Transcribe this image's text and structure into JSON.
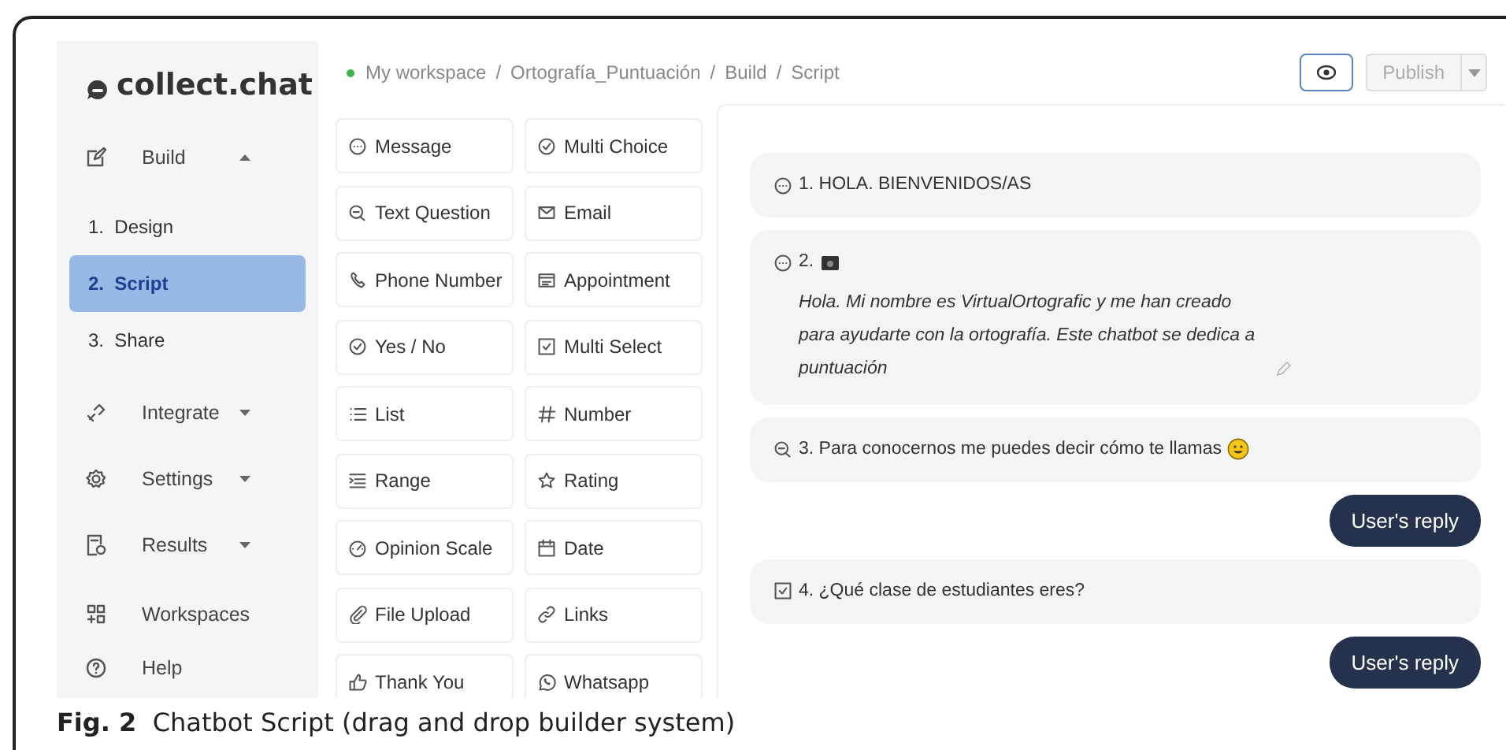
{
  "sidebar": {
    "logo": "collect.chat",
    "items": [
      {
        "label": "Build",
        "expanded": true,
        "children": [
          {
            "label": "1.  Design",
            "selected": false
          },
          {
            "label": "2.  Script",
            "selected": true
          },
          {
            "label": "3.  Share",
            "selected": false
          }
        ]
      },
      {
        "label": "Integrate",
        "expanded": false
      },
      {
        "label": "Settings",
        "expanded": false
      },
      {
        "label": "Results",
        "expanded": false
      }
    ],
    "footer_items": [
      {
        "label": "Workspaces"
      },
      {
        "label": "Help"
      }
    ]
  },
  "breadcrumb": {
    "separator": "/",
    "items": [
      "My workspace",
      "Ortografía_Puntuación",
      "Build",
      "Script"
    ]
  },
  "publish_button": {
    "label": "Publish",
    "disabled": true
  },
  "blocks": [
    {
      "label": "Message"
    },
    {
      "label": "Multi Choice"
    },
    {
      "label": "Text Question"
    },
    {
      "label": "Email"
    },
    {
      "label": "Phone Number"
    },
    {
      "label": "Appointment"
    },
    {
      "label": "Yes / No"
    },
    {
      "label": "Multi Select"
    },
    {
      "label": "List"
    },
    {
      "label": "Number"
    },
    {
      "label": "Range"
    },
    {
      "label": "Rating"
    },
    {
      "label": "Opinion Scale"
    },
    {
      "label": "Date"
    },
    {
      "label": "File Upload"
    },
    {
      "label": "Links"
    },
    {
      "label": "Thank You"
    },
    {
      "label": "Whatsapp"
    }
  ],
  "script": [
    {
      "kind": "message",
      "text": "1. HOLA. BIENVENIDOS/AS"
    },
    {
      "kind": "media_message",
      "text": "2.",
      "body": "Hola. Mi nombre es VirtualOrtografic y me han creado para ayudarte con la ortografía. Este chatbot se dedica a puntuación"
    },
    {
      "kind": "question",
      "text": "3. Para conocernos me puedes decir cómo te llamas"
    },
    {
      "kind": "reply",
      "text": "User's reply"
    },
    {
      "kind": "choice",
      "text": "4. ¿Qué clase de estudiantes eres?"
    },
    {
      "kind": "reply",
      "text": "User's reply"
    }
  ],
  "caption": "**Fig. 2**  Chatbot Script (drag and drop builder system)"
}
